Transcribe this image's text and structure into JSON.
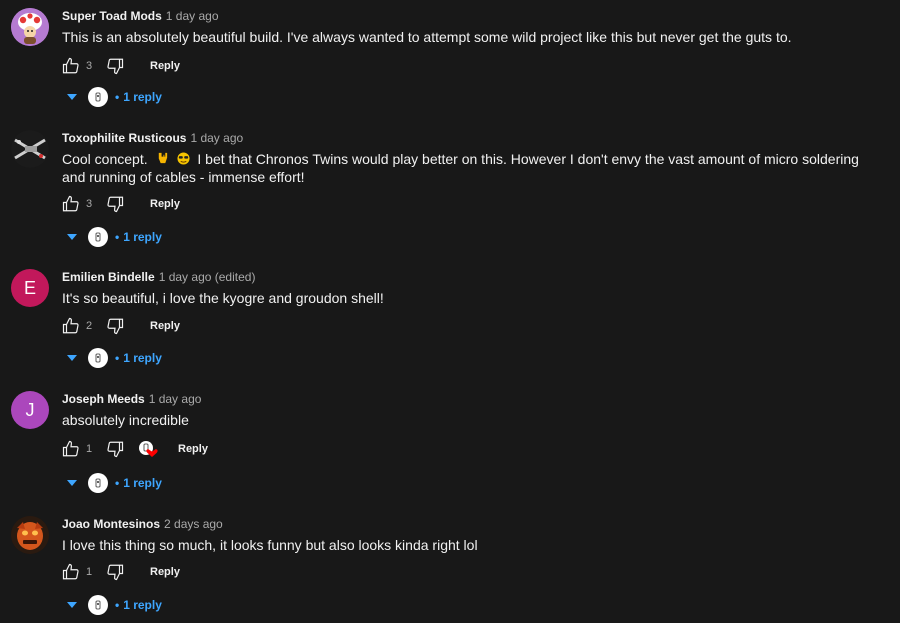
{
  "comments": [
    {
      "author": "Super Toad Mods",
      "time": "1 day ago",
      "text": "This is an absolutely beautiful build. I've always wanted to attempt some wild project like this but never get the guts to.",
      "likes": "3",
      "reply_label": "Reply",
      "replies_label": "1 reply",
      "avatar": "toad-avatar-icon"
    },
    {
      "author": "Toxophilite Rusticous",
      "time": "1 day ago",
      "text_before": "Cool concept.",
      "text_after": "I bet that Chronos Twins would play better on this. However I don't envy the vast amount of micro soldering and running of cables - immense effort!",
      "emojis": [
        "metal-horns-emoji-icon",
        "sunglasses-emoji-icon"
      ],
      "likes": "3",
      "reply_label": "Reply",
      "replies_label": "1 reply",
      "avatar": "xwing-avatar-icon"
    },
    {
      "author": "Emilien Bindelle",
      "time": "1 day ago (edited)",
      "text": "It's so beautiful, i love the kyogre and groudon shell!",
      "likes": "2",
      "reply_label": "Reply",
      "replies_label": "1 reply",
      "avatar_letter": "E",
      "avatar_color": "#c2185b"
    },
    {
      "author": "Joseph Meeds",
      "time": "1 day ago",
      "text": "absolutely incredible",
      "likes": "1",
      "reply_label": "Reply",
      "replies_label": "1 reply",
      "avatar_letter": "J",
      "avatar_color": "#ab47bc",
      "creator_heart": true
    },
    {
      "author": "Joao Montesinos",
      "time": "2 days ago",
      "text": "I love this thing so much, it looks funny but also looks kinda right lol",
      "likes": "1",
      "reply_label": "Reply",
      "replies_label": "1 reply",
      "avatar": "orange-face-avatar-icon"
    }
  ],
  "colors": {
    "background": "#181818",
    "text": "#f1f1f1",
    "secondary": "#aaaaaa",
    "link": "#3ea6ff",
    "heart": "#ff0000"
  }
}
